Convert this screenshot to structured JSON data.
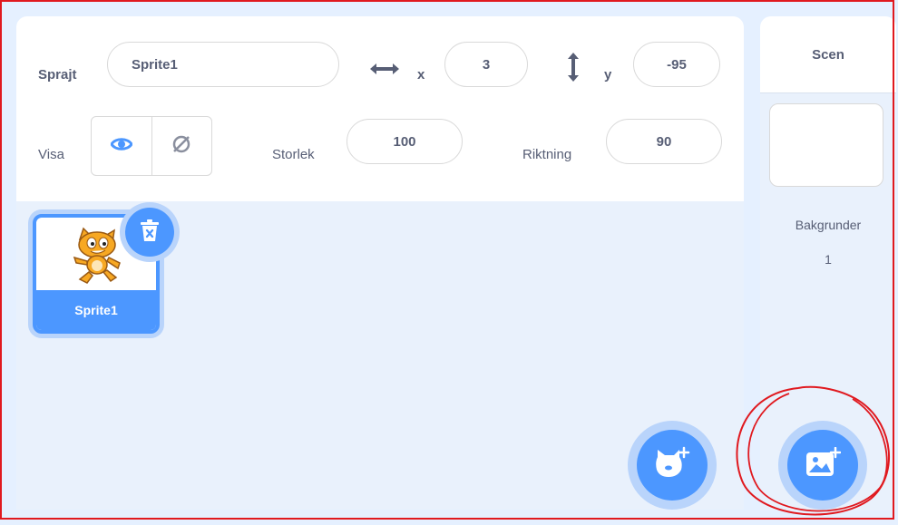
{
  "sprite_info": {
    "sprite_label": "Sprajt",
    "sprite_name": "Sprite1",
    "x_label": "x",
    "x_value": "3",
    "y_label": "y",
    "y_value": "-95",
    "show_label": "Visa",
    "size_label": "Storlek",
    "size_value": "100",
    "direction_label": "Riktning",
    "direction_value": "90"
  },
  "sprites": [
    {
      "name": "Sprite1",
      "selected": true
    }
  ],
  "stage": {
    "title": "Scen",
    "backdrops_label": "Bakgrunder",
    "backdrops_count": "1"
  },
  "icons": {
    "arrows_x": "horizontal-arrows-icon",
    "arrows_y": "vertical-arrows-icon",
    "show": "eye-icon",
    "hide": "eye-slash-icon",
    "delete": "trash-icon",
    "choose_sprite": "cat-plus-icon",
    "choose_backdrop": "image-plus-icon"
  },
  "colors": {
    "accent": "#4c97ff",
    "accent_light": "#b9d4fb",
    "panel_bg": "#e9f1fc",
    "text": "#575e75",
    "annotation": "#e0191f"
  }
}
